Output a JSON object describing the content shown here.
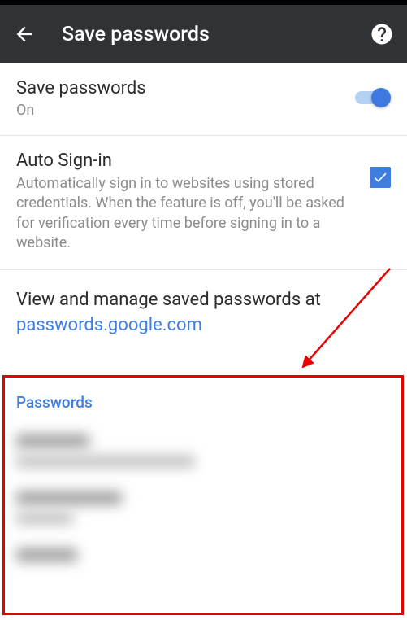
{
  "header": {
    "title": "Save passwords"
  },
  "savePasswords": {
    "title": "Save passwords",
    "status": "On"
  },
  "autoSignIn": {
    "title": "Auto Sign-in",
    "description": "Automatically sign in to websites using stored credentials. When the feature is off, you'll be asked for verification every time before signing in to a website."
  },
  "viewManage": {
    "text": "View and manage saved passwords at ",
    "link": "passwords.google.com"
  },
  "passwords": {
    "header": "Passwords"
  }
}
